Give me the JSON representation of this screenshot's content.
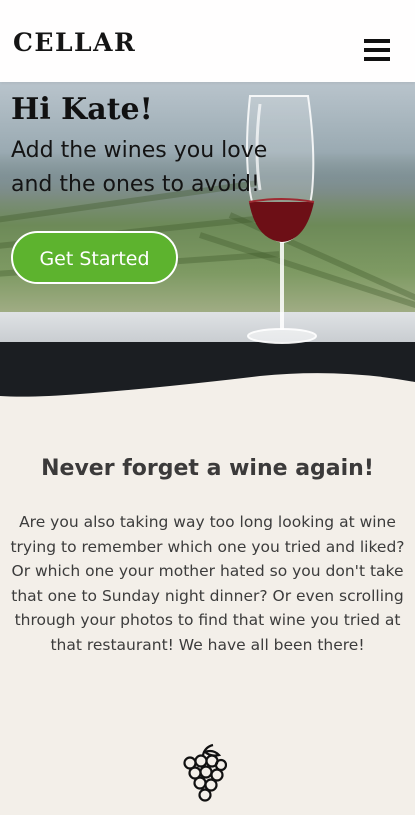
{
  "header": {
    "logo": "CELLAR",
    "menu_icon": "hamburger-menu-icon"
  },
  "hero": {
    "greeting": "Hi Kate!",
    "tagline": "Add the wines you love and the ones to avoid!",
    "cta_label": "Get Started",
    "cta_color": "#5db32e"
  },
  "about": {
    "title": "Never forget a wine again!",
    "body": "Are you also taking way too long looking at wine trying to remember which one you tried and liked? Or which one your mother hated so you don't take that one to Sunday night dinner? Or even scrolling through your photos to find that wine you tried at that restaurant! We have all been there!"
  },
  "icons": {
    "grapes": "grapes-icon"
  },
  "colors": {
    "background": "#f3efe9",
    "dark": "#1b1e22"
  }
}
